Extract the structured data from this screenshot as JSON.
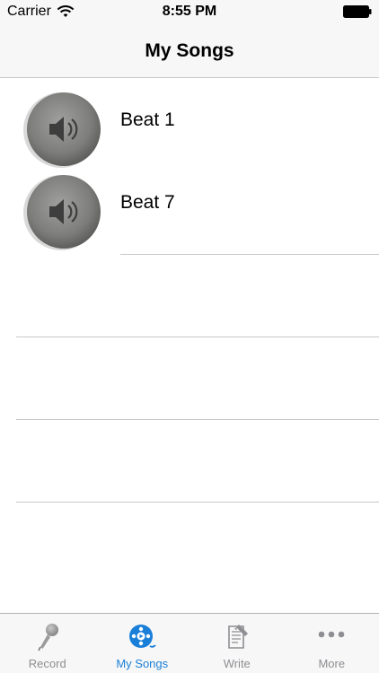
{
  "status_bar": {
    "carrier": "Carrier",
    "time": "8:55 PM"
  },
  "nav": {
    "title": "My Songs"
  },
  "songs": [
    {
      "title": "Beat 1",
      "icon": "speaker-icon"
    },
    {
      "title": "Beat 7",
      "icon": "speaker-icon"
    }
  ],
  "tabbar": {
    "tabs": [
      {
        "label": "Record",
        "icon": "microphone-icon",
        "active": false
      },
      {
        "label": "My Songs",
        "icon": "music-disc-icon",
        "active": true
      },
      {
        "label": "Write",
        "icon": "notepad-pen-icon",
        "active": false
      },
      {
        "label": "More",
        "icon": "more-dots-icon",
        "active": false
      }
    ]
  },
  "colors": {
    "tint": "#1a7fd9",
    "inactive": "#8e8e93",
    "separator": "#c8c7cc",
    "bar_background": "#f7f7f7"
  }
}
